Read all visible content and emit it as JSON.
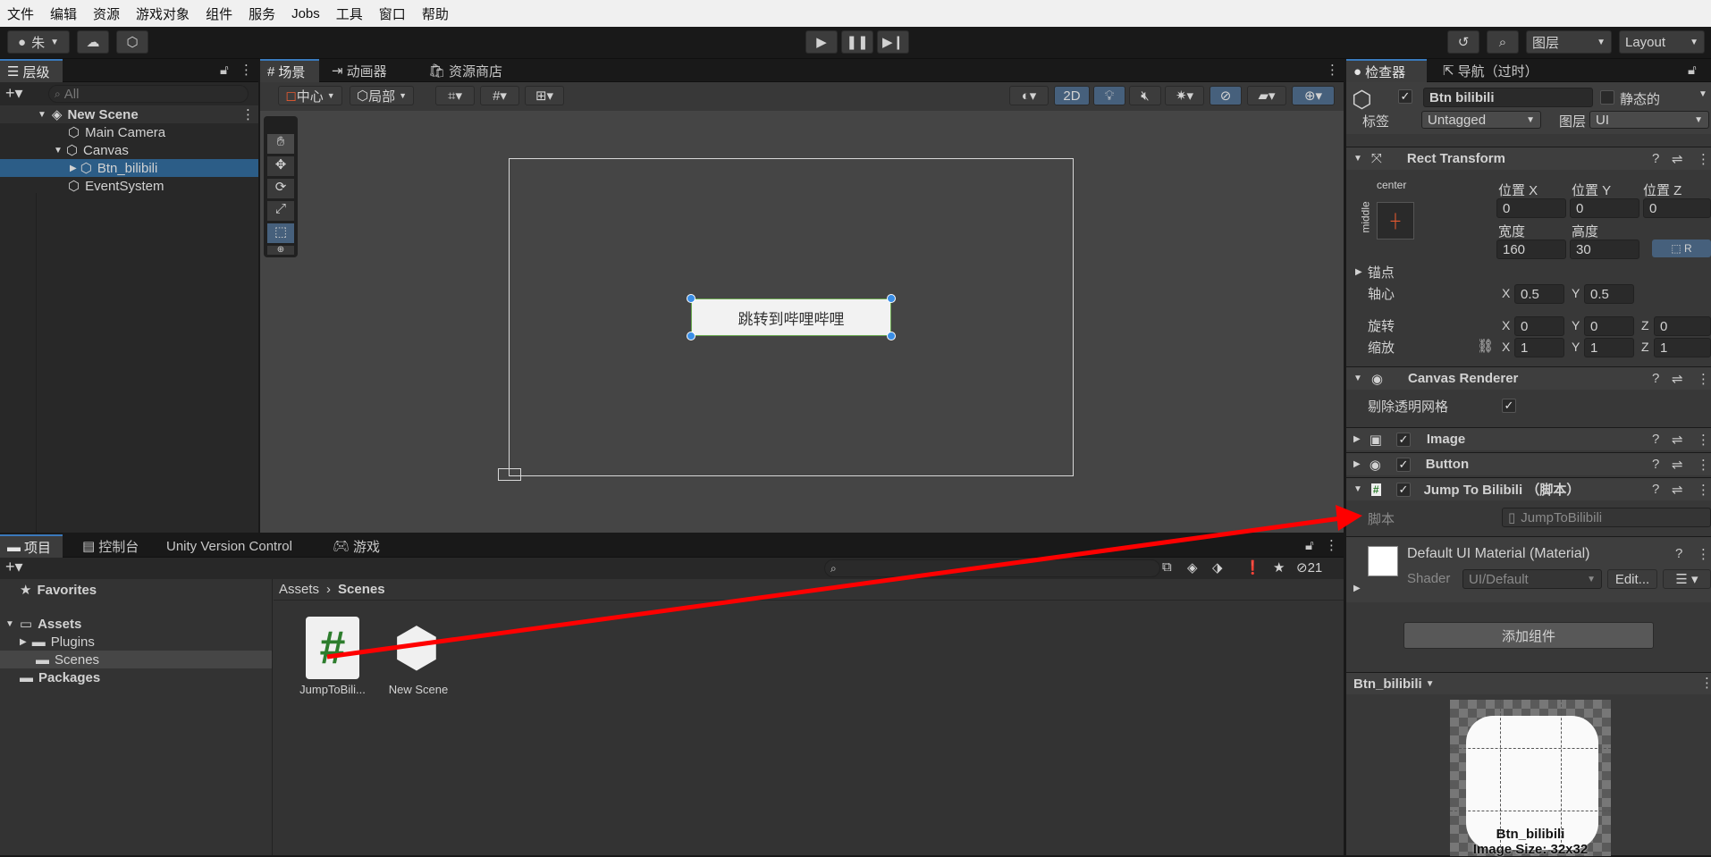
{
  "menu": [
    "文件",
    "编辑",
    "资源",
    "游戏对象",
    "组件",
    "服务",
    "Jobs",
    "工具",
    "窗口",
    "帮助"
  ],
  "toolbar": {
    "account_initial": "朱",
    "layers_label": "图层",
    "layout_label": "Layout"
  },
  "hierarchy": {
    "tab_label": "层级",
    "search_placeholder": "All",
    "scene_name": "New Scene",
    "items": [
      {
        "label": "Main Camera"
      },
      {
        "label": "Canvas"
      },
      {
        "label": "Btn_bilibili"
      },
      {
        "label": "EventSystem"
      }
    ]
  },
  "scene_view": {
    "tabs": [
      "场景",
      "动画器",
      "资源商店"
    ],
    "pivot_label": "中心",
    "space_label": "局部",
    "mode_2d": "2D",
    "button_text": "跳转到哔哩哔哩"
  },
  "inspector": {
    "tabs": [
      "检查器",
      "导航（过时）"
    ],
    "object_name": "Btn bilibili",
    "static_label": "静态的",
    "tag_label": "标签",
    "tag_value": "Untagged",
    "layer_label": "图层",
    "layer_value": "UI",
    "rect_transform": {
      "title": "Rect Transform",
      "anchor_h": "center",
      "anchor_v": "middle",
      "pos_x_label": "位置 X",
      "pos_y_label": "位置 Y",
      "pos_z_label": "位置 Z",
      "pos_x": "0",
      "pos_y": "0",
      "pos_z": "0",
      "width_label": "宽度",
      "height_label": "高度",
      "width": "160",
      "height": "30",
      "anchors_label": "锚点",
      "pivot_label": "轴心",
      "pivot_x": "0.5",
      "pivot_y": "0.5",
      "rotation_label": "旋转",
      "rot_x": "0",
      "rot_y": "0",
      "rot_z": "0",
      "scale_label": "缩放",
      "scale_x": "1",
      "scale_y": "1",
      "scale_z": "1",
      "x": "X",
      "y": "Y",
      "z": "Z"
    },
    "canvas_renderer": {
      "title": "Canvas Renderer",
      "cull_label": "剔除透明网格"
    },
    "image_title": "Image",
    "button_title": "Button",
    "script_component": {
      "title": "Jump To Bilibili （脚本）",
      "script_label": "脚本",
      "script_value": "JumpToBilibili"
    },
    "material": {
      "name": "Default UI Material (Material)",
      "shader_label": "Shader",
      "shader_value": "UI/Default",
      "edit_label": "Edit..."
    },
    "add_component": "添加组件",
    "preview": {
      "object": "Btn_bilibili",
      "caption_name": "Btn_bilibili",
      "image_size": "Image Size: 32x32"
    }
  },
  "project": {
    "tabs": [
      "项目",
      "控制台",
      "Unity Version Control",
      "游戏"
    ],
    "badge_count": "21",
    "tree": {
      "favorites": "Favorites",
      "assets": "Assets",
      "plugins": "Plugins",
      "scenes": "Scenes",
      "packages": "Packages"
    },
    "breadcrumb": [
      "Assets",
      "Scenes"
    ],
    "assets": [
      {
        "label": "JumpToBili..."
      },
      {
        "label": "New Scene"
      }
    ]
  },
  "colors": {
    "accent": "#3a79bb",
    "arrow": "#ff0000",
    "selection": "#2c5d87",
    "script_icon": "#2d7d2d"
  }
}
